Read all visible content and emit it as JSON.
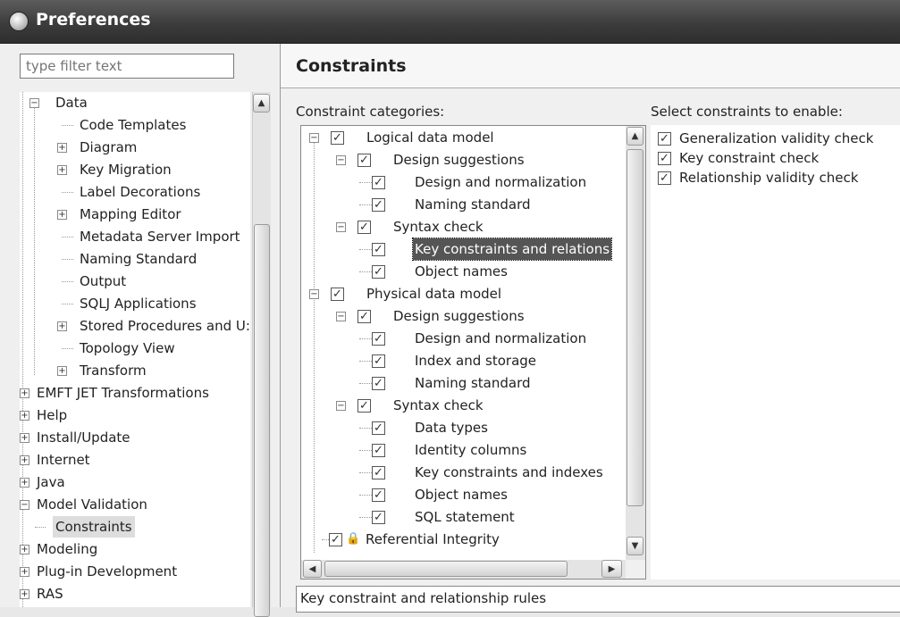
{
  "window": {
    "title": "Preferences"
  },
  "filter": {
    "placeholder": "type filter text"
  },
  "nav": {
    "items": [
      {
        "label": "Data",
        "exp": "−"
      },
      {
        "label": "Code Templates"
      },
      {
        "label": "Diagram",
        "exp": "+"
      },
      {
        "label": "Key Migration",
        "exp": "+"
      },
      {
        "label": "Label Decorations"
      },
      {
        "label": "Mapping Editor",
        "exp": "+"
      },
      {
        "label": "Metadata Server Import"
      },
      {
        "label": "Naming Standard"
      },
      {
        "label": "Output"
      },
      {
        "label": "SQLJ Applications"
      },
      {
        "label": "Stored Procedures and U:",
        "exp": "+"
      },
      {
        "label": "Topology View"
      },
      {
        "label": "Transform",
        "exp": "+"
      },
      {
        "label": "EMFT JET Transformations",
        "exp": "+"
      },
      {
        "label": "Help",
        "exp": "+"
      },
      {
        "label": "Install/Update",
        "exp": "+"
      },
      {
        "label": "Internet",
        "exp": "+"
      },
      {
        "label": "Java",
        "exp": "+"
      },
      {
        "label": "Model Validation",
        "exp": "−"
      },
      {
        "label": "Constraints",
        "selected": true
      },
      {
        "label": "Modeling",
        "exp": "+"
      },
      {
        "label": "Plug-in Development",
        "exp": "+"
      },
      {
        "label": "RAS",
        "exp": "+"
      }
    ]
  },
  "page": {
    "title": "Constraints",
    "categories_label": "Constraint categories:",
    "select_label": "Select constraints to enable:",
    "description": "Key constraint and relationship rules"
  },
  "categories": [
    {
      "label": "Logical data model",
      "exp": "−"
    },
    {
      "label": "Design suggestions",
      "exp": "−"
    },
    {
      "label": "Design and normalization"
    },
    {
      "label": "Naming standard"
    },
    {
      "label": "Syntax check",
      "exp": "−"
    },
    {
      "label": "Key constraints and relations",
      "selected": true
    },
    {
      "label": "Object names"
    },
    {
      "label": "Physical data model",
      "exp": "−"
    },
    {
      "label": "Design suggestions",
      "exp": "−"
    },
    {
      "label": "Design and normalization"
    },
    {
      "label": "Index and storage"
    },
    {
      "label": "Naming standard"
    },
    {
      "label": "Syntax check",
      "exp": "−"
    },
    {
      "label": "Data types"
    },
    {
      "label": "Identity columns"
    },
    {
      "label": "Key constraints and indexes"
    },
    {
      "label": "Object names"
    },
    {
      "label": "SQL statement"
    },
    {
      "label": "Referential Integrity",
      "locked": true
    }
  ],
  "constraints": [
    {
      "label": "Generalization validity check",
      "checked": true
    },
    {
      "label": "Key constraint check",
      "checked": true
    },
    {
      "label": "Relationship validity check",
      "checked": true
    }
  ],
  "icons": {
    "check": "✓",
    "scroll_up": "▲",
    "scroll_down": "▼",
    "scroll_left": "◀",
    "scroll_right": "▶",
    "lock": "🔒"
  }
}
